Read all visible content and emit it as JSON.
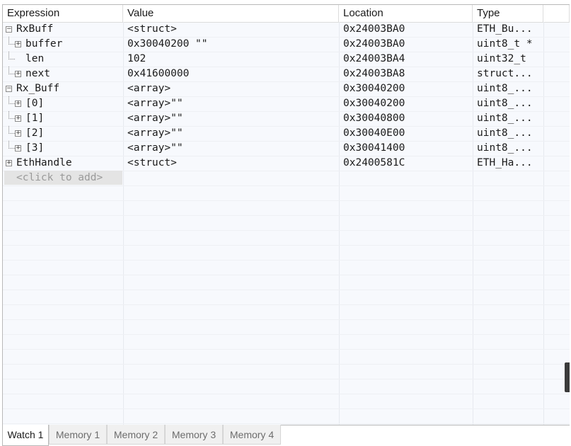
{
  "columns": {
    "expression": "Expression",
    "value": "Value",
    "location": "Location",
    "type": "Type"
  },
  "rows": [
    {
      "expr": "RxBuff",
      "value": "<struct>",
      "location": "0x24003BA0",
      "type": "ETH_Bu...",
      "level": 0,
      "toggle": "minus"
    },
    {
      "expr": "buffer",
      "value": "0x30040200 \"\"",
      "location": "0x24003BA0",
      "type": "uint8_t *",
      "level": 1,
      "toggle": "plus"
    },
    {
      "expr": "len",
      "value": "102",
      "location": "0x24003BA4",
      "type": "uint32_t",
      "level": 1,
      "toggle": "none"
    },
    {
      "expr": "next",
      "value": "0x41600000",
      "location": "0x24003BA8",
      "type": "struct...",
      "level": 1,
      "toggle": "plus"
    },
    {
      "expr": "Rx_Buff",
      "value": "<array>",
      "location": "0x30040200",
      "type": "uint8_...",
      "level": 0,
      "toggle": "minus"
    },
    {
      "expr": "[0]",
      "value": "<array>\"\"",
      "location": "0x30040200",
      "type": "uint8_...",
      "level": 1,
      "toggle": "plus"
    },
    {
      "expr": "[1]",
      "value": "<array>\"\"",
      "location": "0x30040800",
      "type": "uint8_...",
      "level": 1,
      "toggle": "plus"
    },
    {
      "expr": "[2]",
      "value": "<array>\"\"",
      "location": "0x30040E00",
      "type": "uint8_...",
      "level": 1,
      "toggle": "plus"
    },
    {
      "expr": "[3]",
      "value": "<array>\"\"",
      "location": "0x30041400",
      "type": "uint8_...",
      "level": 1,
      "toggle": "plus"
    },
    {
      "expr": "EthHandle",
      "value": "<struct>",
      "location": "0x2400581C",
      "type": "ETH_Ha...",
      "level": 0,
      "toggle": "plus"
    }
  ],
  "add_row": "<click to add>",
  "tabs": [
    {
      "label": "Watch 1",
      "active": true
    },
    {
      "label": "Memory 1",
      "active": false
    },
    {
      "label": "Memory 2",
      "active": false
    },
    {
      "label": "Memory 3",
      "active": false
    },
    {
      "label": "Memory 4",
      "active": false
    }
  ],
  "icons": {
    "expanded": "minus-box-icon",
    "collapsed": "plus-box-icon"
  }
}
